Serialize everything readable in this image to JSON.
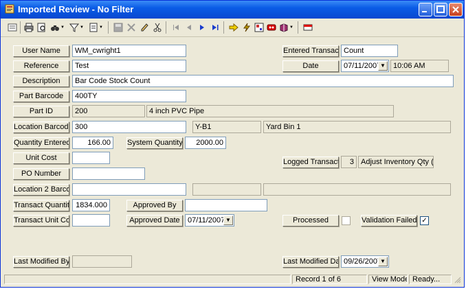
{
  "window": {
    "title": "Imported Review - No Filter"
  },
  "fields": {
    "user_name": {
      "label": "User Name",
      "value": "WM_cwright1"
    },
    "entered_transact": {
      "label": "Entered Transact",
      "value": "Count"
    },
    "reference": {
      "label": "Reference",
      "value": "Test"
    },
    "date": {
      "label": "Date",
      "value": "07/11/2007",
      "time": "10:06 AM"
    },
    "description": {
      "label": "Description",
      "value": "Bar Code Stock Count"
    },
    "part_barcode": {
      "label": "Part Barcode",
      "value": "400TY"
    },
    "part_id": {
      "label": "Part ID",
      "value": "200",
      "desc": "4 inch PVC Pipe"
    },
    "location_barcode": {
      "label": "Location Barcode",
      "value": "300",
      "code": "Y-B1",
      "name": "Yard Bin 1"
    },
    "quantity_entered": {
      "label": "Quantity Entered",
      "value": "166.00"
    },
    "system_quantity": {
      "label": "System Quantity",
      "value": "2000.00"
    },
    "unit_cost": {
      "label": "Unit Cost",
      "value": ""
    },
    "logged_transact": {
      "label": "Logged Transact",
      "code": "3",
      "value": "Adjust Inventory Qty (-)"
    },
    "po_number": {
      "label": "PO Number",
      "value": ""
    },
    "location2_barcode": {
      "label": "Location 2 Barcode",
      "value": ""
    },
    "transact_quantity": {
      "label": "Transact Quantity",
      "value": "1834.000"
    },
    "approved_by": {
      "label": "Approved By",
      "value": ""
    },
    "transact_unit_cost": {
      "label": "Transact Unit Cost",
      "value": ""
    },
    "approved_date": {
      "label": "Approved Date",
      "value": "07/11/2007"
    },
    "processed": {
      "label": "Processed",
      "checked": false
    },
    "validation_failed": {
      "label": "Validation Failed",
      "checked": true,
      "mark": "✓"
    },
    "last_modified_by": {
      "label": "Last Modified By",
      "value": ""
    },
    "last_modified_date": {
      "label": "Last Modified Date",
      "value": "09/26/2007"
    }
  },
  "status": {
    "record": "Record 1 of 6",
    "mode": "View Mode",
    "state": "Ready..."
  },
  "glyphs": {
    "dropdown": "▼"
  },
  "colors": {
    "titlebar": "#0a5ce6",
    "face": "#ece9d8"
  }
}
